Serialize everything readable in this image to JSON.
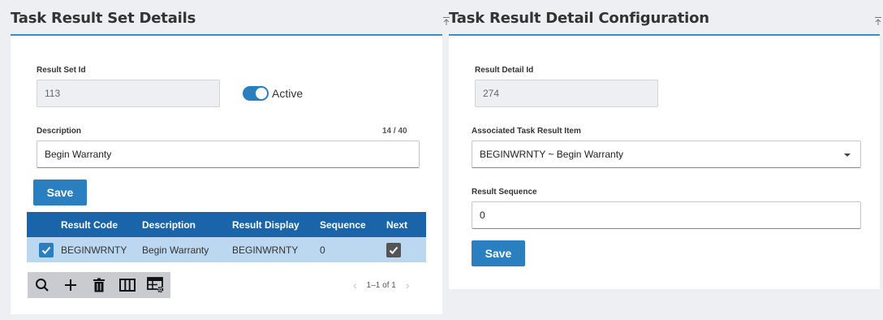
{
  "left_panel": {
    "title": "Task Result Set Details",
    "result_set_id_label": "Result Set Id",
    "result_set_id_value": "113",
    "active_label": "Active",
    "active_on": true,
    "description_label": "Description",
    "description_counter": "14 / 40",
    "description_value": "Begin Warranty",
    "save_label": "Save",
    "table": {
      "headers": [
        "Result Code",
        "Description",
        "Result Display",
        "Sequence",
        "Next"
      ],
      "rows": [
        {
          "selected": true,
          "result_code": "BEGINWRNTY",
          "description": "Begin Warranty",
          "result_display": "BEGINWRNTY",
          "sequence": "0",
          "next": true
        }
      ]
    },
    "toolbar": [
      "search-icon",
      "add-icon",
      "delete-icon",
      "columns-icon",
      "grid-settings-icon"
    ],
    "pager_text": "1–1 of 1"
  },
  "right_panel": {
    "title": "Task Result Detail Configuration",
    "result_detail_id_label": "Result Detail Id",
    "result_detail_id_value": "274",
    "associated_item_label": "Associated Task Result Item",
    "associated_item_value": "BEGINWRNTY ~ Begin Warranty",
    "result_sequence_label": "Result Sequence",
    "result_sequence_value": "0",
    "save_label": "Save"
  },
  "colors": {
    "accent": "#2a7fc0",
    "table_header": "#1a64aa",
    "row_selected": "#bcd8f0",
    "page_bg": "#eeeff2"
  }
}
